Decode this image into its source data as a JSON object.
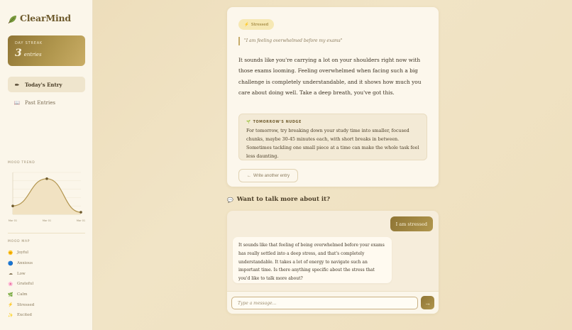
{
  "app": {
    "name": "ClearMind",
    "brand_icon": "leaf-icon"
  },
  "colors": {
    "accent": "#a58a45",
    "accent_dark": "#8f7535",
    "sidebar_bg": "#fbf6ea",
    "page_bg": "#efe2c2",
    "stressed_badge": "#f6e8b4"
  },
  "streak": {
    "label": "DAY STREAK",
    "value": "3",
    "unit": "entries"
  },
  "nav": {
    "items": [
      {
        "label": "Today's Entry",
        "icon": "pencil-icon",
        "active": true
      },
      {
        "label": "Past Entries",
        "icon": "book-icon",
        "active": false
      }
    ]
  },
  "mood_trend": {
    "label": "MOOD TREND"
  },
  "chart_data": {
    "type": "area",
    "categories": [
      "Mar 01",
      "Mar 01",
      "Mar 01"
    ],
    "values": [
      2,
      8.5,
      0.5
    ],
    "ylim": [
      0,
      10
    ],
    "grid": true,
    "title": "MOOD TREND"
  },
  "mood_map": {
    "label": "MOOD MAP",
    "items": [
      {
        "label": "Joyful",
        "icon": "sun-icon"
      },
      {
        "label": "Anxious",
        "icon": "blue-dot-icon"
      },
      {
        "label": "Low",
        "icon": "cloud-icon"
      },
      {
        "label": "Grateful",
        "icon": "flower-icon"
      },
      {
        "label": "Calm",
        "icon": "leaf-icon"
      },
      {
        "label": "Stressed",
        "icon": "lightning-icon"
      },
      {
        "label": "Excited",
        "icon": "sparkle-icon"
      }
    ]
  },
  "entry": {
    "mood_badge": "Stressed",
    "mood_badge_icon": "lightning-icon",
    "quote": "\"I am feeling overwhelmed before my exams\"",
    "response": "It sounds like you're carrying a lot on your shoulders right now with those exams looming. Feeling overwhelmed when facing such a big challenge is completely understandable, and it shows how much you care about doing well. Take a deep breath, you've got this.",
    "nudge_title": "TOMORROW'S NUDGE",
    "nudge_icon": "sprout-icon",
    "nudge_body": "For tomorrow, try breaking down your study time into smaller, focused chunks, maybe 30-45 minutes each, with short breaks in between. Sometimes tackling one small piece at a time can make the whole task feel less daunting.",
    "another_button": "Write another entry",
    "another_button_icon": "arrow-left-icon"
  },
  "chat": {
    "heading": "Want to talk more about it?",
    "heading_icon": "speech-bubble-icon",
    "messages": [
      {
        "role": "user",
        "text": "I am stressed"
      },
      {
        "role": "assistant",
        "text": "It sounds like that feeling of being overwhelmed before your exams has really settled into a deep stress, and that's completely understandable. It takes a lot of energy to navigate such an important time. Is there anything specific about the stress that you'd like to talk more about?"
      }
    ],
    "input_placeholder": "Type a message...",
    "send_icon": "arrow-right-icon"
  }
}
